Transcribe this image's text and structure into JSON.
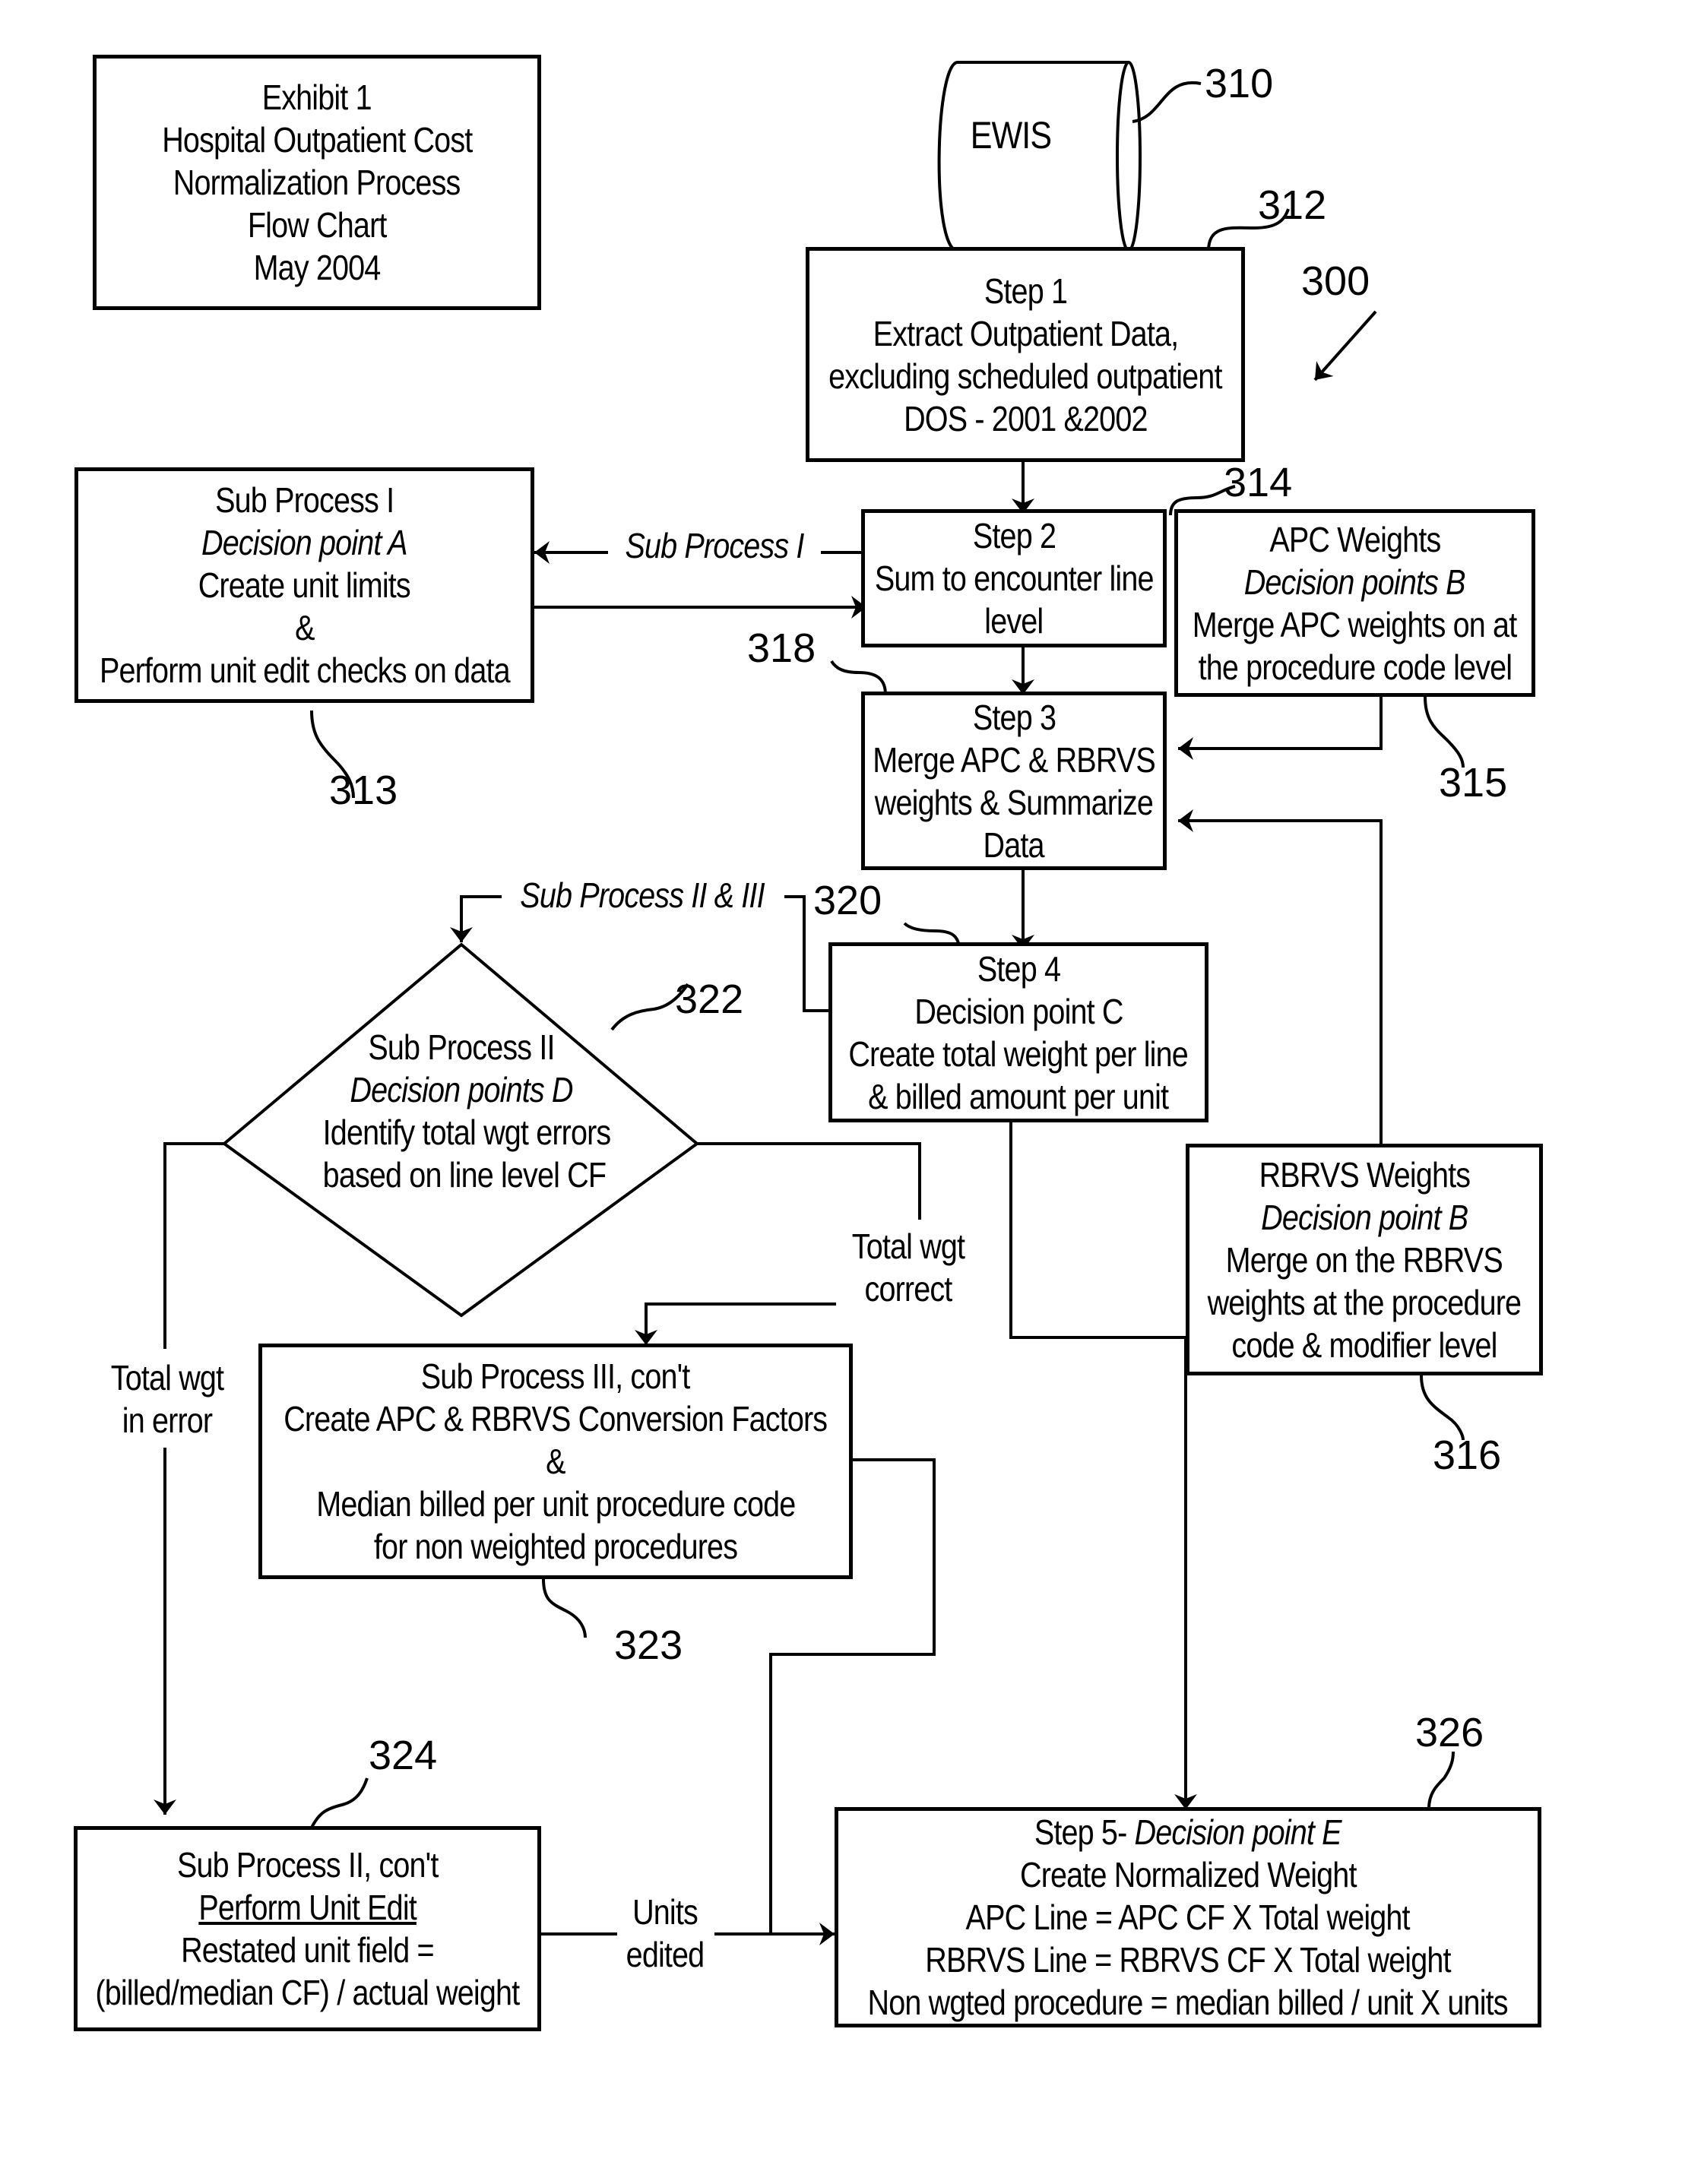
{
  "title_box": {
    "lines": [
      "Exhibit 1",
      "Hospital Outpatient Cost",
      "Normalization Process",
      "Flow Chart",
      "May 2004"
    ]
  },
  "nodes": {
    "ewis": {
      "label": "EWIS",
      "ref": "310"
    },
    "step1": {
      "ref": "312",
      "lines": [
        "Step 1",
        "Extract Outpatient Data,",
        "excluding scheduled outpatient",
        "DOS - 2001 &2002"
      ]
    },
    "figure_ref": "300",
    "sub1": {
      "ref": "313",
      "lines": [
        "Sub Process I",
        "Decision point A",
        "Create unit limits",
        "&",
        "Perform unit edit checks on data"
      ]
    },
    "step2": {
      "ref": "314",
      "lines": [
        "Step 2",
        "Sum to encounter line",
        "level"
      ]
    },
    "apc": {
      "ref": "315",
      "lines": [
        "APC Weights",
        "Decision points B",
        "Merge APC weights on at",
        "the procedure code level"
      ]
    },
    "step3": {
      "ref": "318",
      "lines": [
        "Step 3",
        "Merge APC & RBRVS",
        "weights & Summarize",
        "Data"
      ]
    },
    "step4": {
      "ref": "320",
      "lines": [
        "Step 4",
        "Decision point C",
        "Create total weight per line",
        "& billed amount per unit"
      ]
    },
    "rbrvs": {
      "ref": "316",
      "lines": [
        "RBRVS Weights",
        "Decision point B",
        "Merge on the RBRVS",
        "weights at the procedure",
        "code & modifier level"
      ]
    },
    "sub2": {
      "ref": "322",
      "lines": [
        "Sub Process II",
        "Decision points D",
        "Identify total wgt errors",
        "based on line level CF"
      ]
    },
    "sub3": {
      "ref": "323",
      "lines": [
        "Sub Process III, con't",
        "Create APC & RBRVS Conversion Factors",
        "&",
        "Median billed per unit procedure code",
        "for non weighted procedures"
      ]
    },
    "sub2b": {
      "ref": "324",
      "lines": [
        "Sub Process II, con't",
        "Perform Unit Edit",
        "Restated unit field =",
        "(billed/median CF) / actual weight"
      ]
    },
    "step5": {
      "ref": "326",
      "lines": [
        "Step 5- ",
        "Decision point E",
        "Create Normalized Weight",
        "APC Line = APC CF X Total weight",
        "RBRVS Line = RBRVS CF X Total weight",
        "Non wgted procedure = median billed / unit X units"
      ]
    }
  },
  "edge_labels": {
    "sub_process_1": "Sub Process I",
    "sub_process_2_3": "Sub Process II & III",
    "total_wgt_correct": [
      "Total wgt",
      "correct"
    ],
    "total_wgt_error": [
      "Total wgt",
      "in error"
    ],
    "units_edited": [
      "Units",
      "edited"
    ]
  }
}
